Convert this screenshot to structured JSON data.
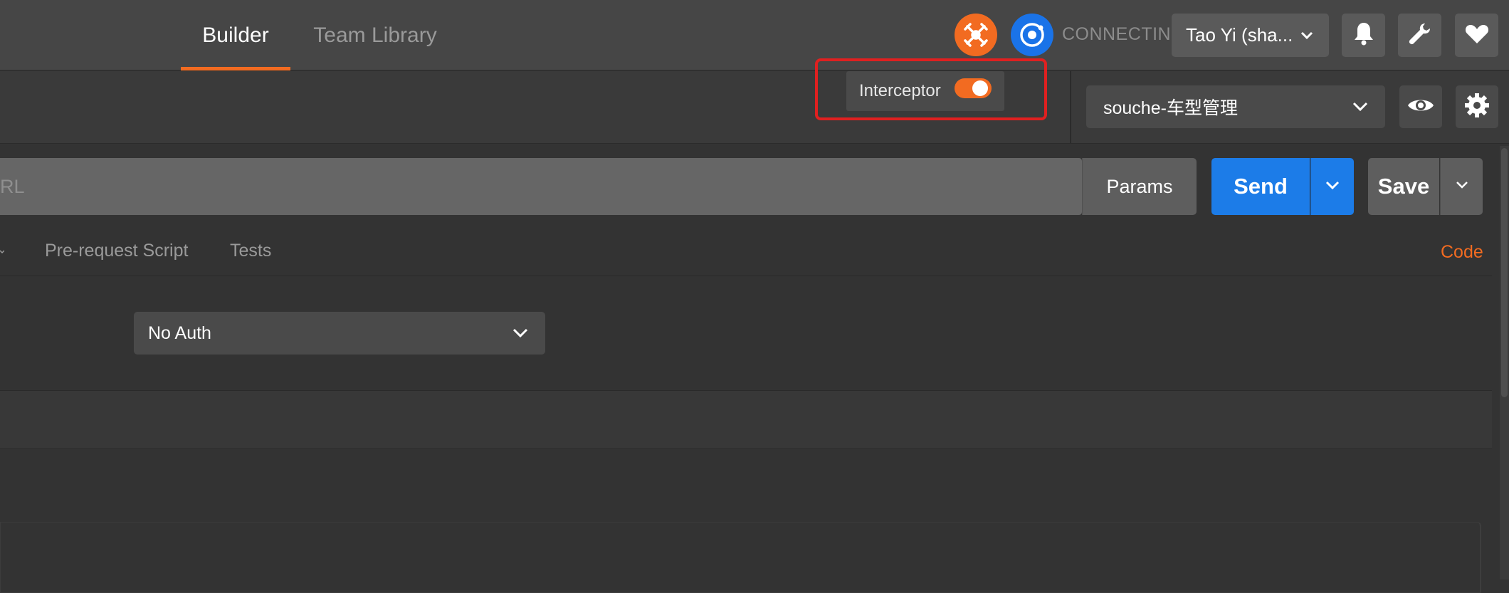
{
  "header": {
    "tabs": [
      {
        "label": "Builder",
        "active": true
      },
      {
        "label": "Team Library",
        "active": false
      }
    ],
    "connection_status": "CONNECTING",
    "user_name": "Tao Yi (sha...",
    "icons": [
      "interceptor-icon",
      "sync-icon",
      "bell-icon",
      "wrench-icon",
      "heart-icon"
    ]
  },
  "interceptor_popup": {
    "label": "Interceptor",
    "enabled": true
  },
  "environment": {
    "selected": "souche-车型管理"
  },
  "request": {
    "url_placeholder": "RL",
    "params_label": "Params",
    "send_label": "Send",
    "save_label": "Save"
  },
  "request_tabs": [
    {
      "label": "Pre-request Script"
    },
    {
      "label": "Tests"
    }
  ],
  "code_link": "Code",
  "auth": {
    "selected": "No Auth"
  },
  "colors": {
    "accent": "#f26b21",
    "send_blue": "#1c7ce8",
    "highlight_red": "#e02020"
  }
}
